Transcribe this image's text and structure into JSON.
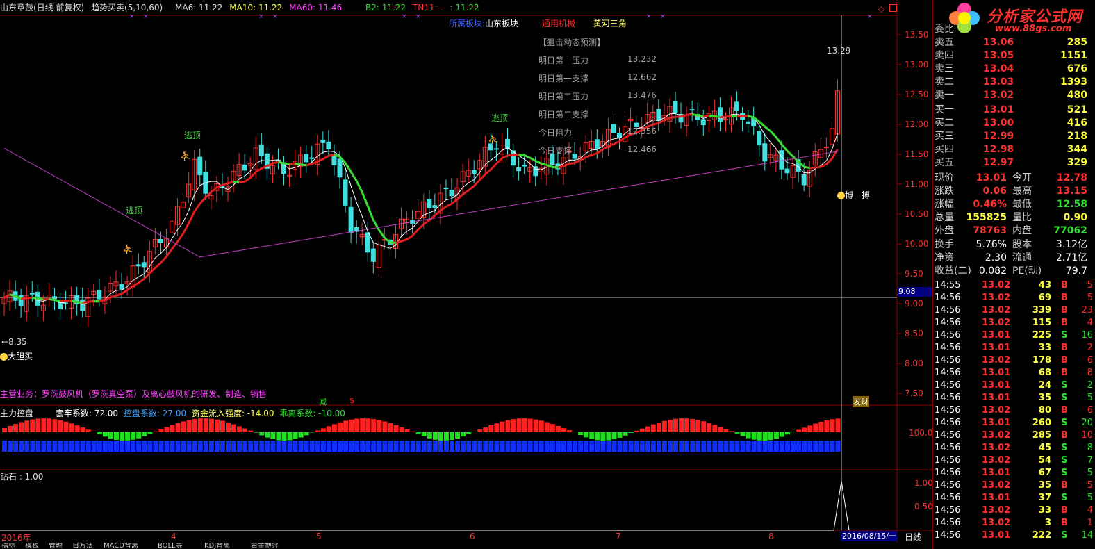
{
  "header": {
    "stock": "山东章鼓(日线 前复权)",
    "indicator": "趋势买卖(5,10,60)",
    "ma6": "MA6: 11.22",
    "ma10": "MA10: 11.22",
    "ma60": "MA60: 11.46",
    "b2": "B2: 11.22",
    "tn": "TN11: -",
    "tn_val": ": 11.22"
  },
  "sector": {
    "label": "所属板块:",
    "region": "山东板块",
    "industry": "通用机械",
    "concept": "黄河三角"
  },
  "forecast": {
    "title": "【狙击动态预测】",
    "items": [
      {
        "label": "明日第一压力",
        "value": "13.232"
      },
      {
        "label": "明日第一支撑",
        "value": "12.662"
      },
      {
        "label": "明日第二压力",
        "value": "13.476"
      },
      {
        "label": "明日第二支撑",
        "value": ""
      },
      {
        "label": "今日阻力",
        "value": "12.356"
      },
      {
        "label": "今日支撑",
        "value": "12.466"
      }
    ]
  },
  "signals": {
    "escape_top_1": "逃顶",
    "escape_top_2": "逃顶",
    "escape_top_3": "逃顶",
    "bold_buy": "大胆买",
    "fight": "博一搏",
    "reduce": "减",
    "dollar": "$",
    "fortune": "发财",
    "low_label": "←8.35",
    "high_label": "13.29"
  },
  "business": "主营业务：罗茨鼓风机（罗茨真空泵）及离心鼓风机的研发、制造、销售",
  "price_axis": [
    "13.50",
    "13.00",
    "12.50",
    "12.00",
    "11.50",
    "11.00",
    "10.50",
    "10.00",
    "9.50",
    "9.00",
    "8.50",
    "8.00",
    "7.50"
  ],
  "cursor_price": "9.08",
  "sub1": {
    "title": "主力控盘",
    "c1": "套牢系数: 72.00",
    "c2": "控盘系数: 27.00",
    "c3": "资金流入强度: -14.00",
    "c4": "乖离系数: -10.00",
    "axis": "100.0"
  },
  "sub2": {
    "title": "钻石 : 1.00",
    "axis": [
      "1.00",
      "0.50"
    ]
  },
  "time_axis": [
    "2016年",
    "4",
    "5",
    "6",
    "7",
    "8"
  ],
  "date_box": "2016/08/15/一",
  "period": "日线",
  "bottom_tabs": [
    "指标",
    "模板",
    "管理",
    "日方法",
    "MACD背离",
    "BOLL等",
    "KDJ背离",
    "资金博弈"
  ],
  "logo": {
    "text": "分析家公式网",
    "url": "www.88gs.com"
  },
  "orderbook": {
    "title": "委比",
    "asks": [
      {
        "label": "卖五",
        "price": "13.06",
        "vol": "285"
      },
      {
        "label": "卖四",
        "price": "13.05",
        "vol": "1151"
      },
      {
        "label": "卖三",
        "price": "13.04",
        "vol": "676"
      },
      {
        "label": "卖二",
        "price": "13.03",
        "vol": "1393"
      },
      {
        "label": "卖一",
        "price": "13.02",
        "vol": "480"
      }
    ],
    "bids": [
      {
        "label": "买一",
        "price": "13.01",
        "vol": "521"
      },
      {
        "label": "买二",
        "price": "13.00",
        "vol": "416"
      },
      {
        "label": "买三",
        "price": "12.99",
        "vol": "218"
      },
      {
        "label": "买四",
        "price": "12.98",
        "vol": "344"
      },
      {
        "label": "买五",
        "price": "12.97",
        "vol": "329"
      }
    ]
  },
  "quote": [
    {
      "l1": "现价",
      "v1": "13.01",
      "l2": "今开",
      "v2": "12.78",
      "c1": "#ff3030",
      "c2": "#ff3030"
    },
    {
      "l1": "涨跌",
      "v1": "0.06",
      "l2": "最高",
      "v2": "13.15",
      "c1": "#ff3030",
      "c2": "#ff3030"
    },
    {
      "l1": "涨幅",
      "v1": "0.46%",
      "l2": "最低",
      "v2": "12.58",
      "c1": "#ff3030",
      "c2": "#30e030"
    },
    {
      "l1": "总量",
      "v1": "155825",
      "l2": "量比",
      "v2": "0.90",
      "c1": "#ffff40",
      "c2": "#ffff40"
    },
    {
      "l1": "外盘",
      "v1": "78763",
      "l2": "内盘",
      "v2": "77062",
      "c1": "#ff3030",
      "c2": "#30e030"
    }
  ],
  "fundamentals": [
    {
      "l1": "换手",
      "v1": "5.76%",
      "l2": "股本",
      "v2": "3.12亿"
    },
    {
      "l1": "净资",
      "v1": "2.30",
      "l2": "流通",
      "v2": "2.71亿"
    },
    {
      "l1": "收益(二)",
      "v1": "0.082",
      "l2": "PE(动)",
      "v2": "79.7"
    }
  ],
  "ticks": [
    {
      "t": "14:55",
      "p": "13.02",
      "v": "43",
      "bs": "B",
      "n": "5"
    },
    {
      "t": "14:56",
      "p": "13.02",
      "v": "69",
      "bs": "B",
      "n": "5"
    },
    {
      "t": "14:56",
      "p": "13.02",
      "v": "339",
      "bs": "B",
      "n": "23"
    },
    {
      "t": "14:56",
      "p": "13.02",
      "v": "115",
      "bs": "B",
      "n": "4"
    },
    {
      "t": "14:56",
      "p": "13.01",
      "v": "225",
      "bs": "S",
      "n": "16"
    },
    {
      "t": "14:56",
      "p": "13.01",
      "v": "33",
      "bs": "B",
      "n": "2"
    },
    {
      "t": "14:56",
      "p": "13.02",
      "v": "178",
      "bs": "B",
      "n": "6"
    },
    {
      "t": "14:56",
      "p": "13.01",
      "v": "68",
      "bs": "B",
      "n": "8"
    },
    {
      "t": "14:56",
      "p": "13.01",
      "v": "24",
      "bs": "S",
      "n": "2"
    },
    {
      "t": "14:56",
      "p": "13.01",
      "v": "35",
      "bs": "S",
      "n": "5"
    },
    {
      "t": "14:56",
      "p": "13.02",
      "v": "80",
      "bs": "B",
      "n": "6"
    },
    {
      "t": "14:56",
      "p": "13.01",
      "v": "260",
      "bs": "S",
      "n": "20"
    },
    {
      "t": "14:56",
      "p": "13.02",
      "v": "285",
      "bs": "B",
      "n": "10"
    },
    {
      "t": "14:56",
      "p": "13.02",
      "v": "45",
      "bs": "S",
      "n": "8"
    },
    {
      "t": "14:56",
      "p": "13.02",
      "v": "54",
      "bs": "S",
      "n": "7"
    },
    {
      "t": "14:56",
      "p": "13.01",
      "v": "67",
      "bs": "S",
      "n": "5"
    },
    {
      "t": "14:56",
      "p": "13.02",
      "v": "35",
      "bs": "B",
      "n": "5"
    },
    {
      "t": "14:56",
      "p": "13.01",
      "v": "37",
      "bs": "S",
      "n": "5"
    },
    {
      "t": "14:56",
      "p": "13.02",
      "v": "33",
      "bs": "B",
      "n": "4"
    },
    {
      "t": "14:56",
      "p": "13.02",
      "v": "3",
      "bs": "B",
      "n": "1"
    },
    {
      "t": "14:56",
      "p": "13.01",
      "v": "222",
      "bs": "S",
      "n": "14"
    }
  ]
}
